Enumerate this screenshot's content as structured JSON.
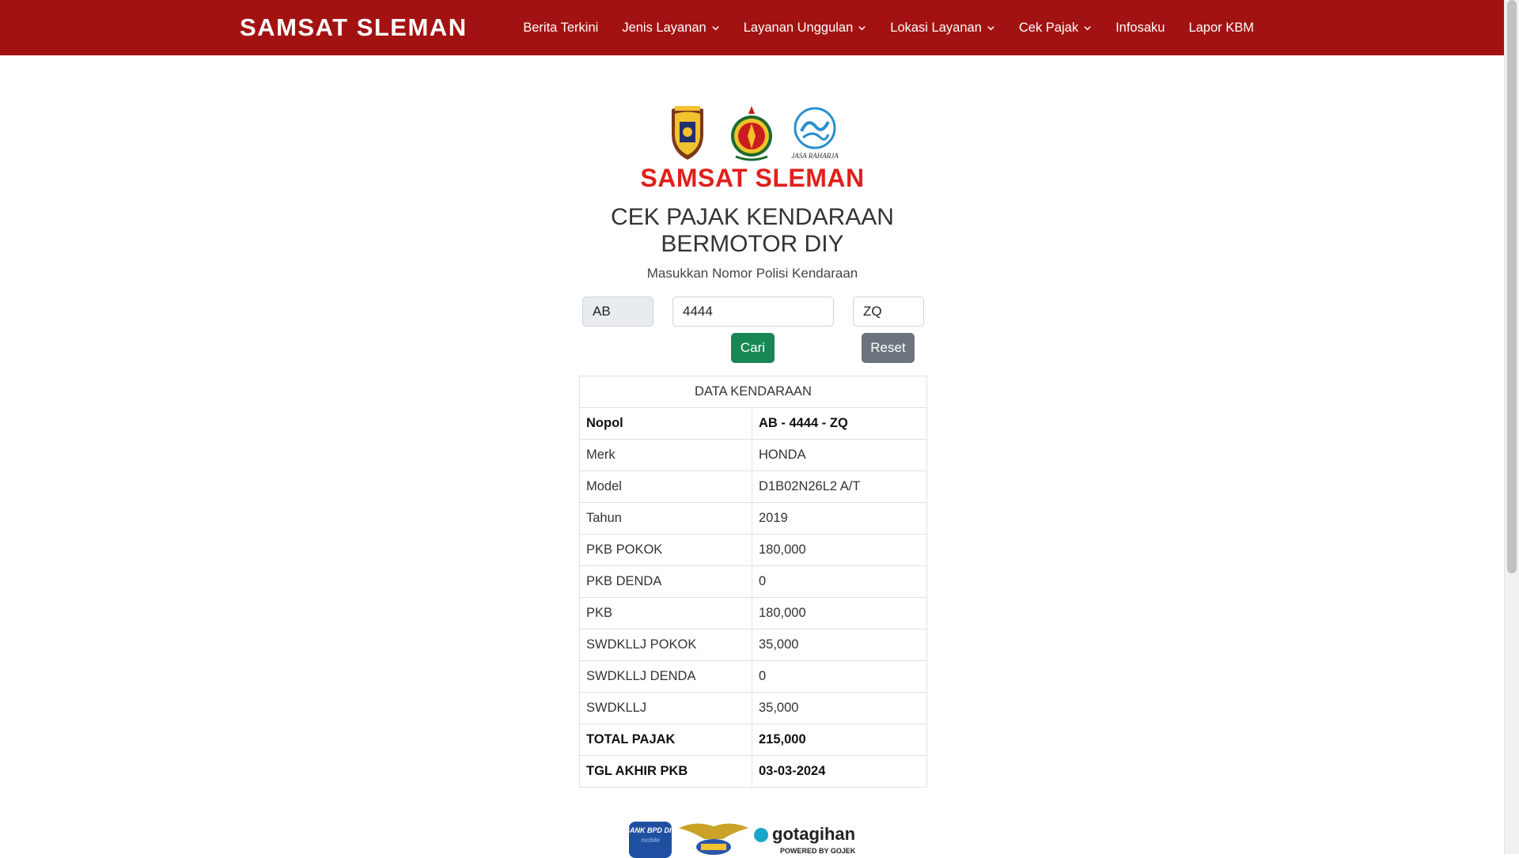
{
  "navbar": {
    "brand": "SAMSAT SLEMAN",
    "items": [
      {
        "label": "Berita Terkini",
        "dropdown": false
      },
      {
        "label": "Jenis Layanan",
        "dropdown": true
      },
      {
        "label": "Layanan Unggulan",
        "dropdown": true
      },
      {
        "label": "Lokasi Layanan",
        "dropdown": true
      },
      {
        "label": "Cek Pajak",
        "dropdown": true
      },
      {
        "label": "Infosaku",
        "dropdown": false
      },
      {
        "label": "Lapor KBM",
        "dropdown": false
      }
    ]
  },
  "header": {
    "logo_title": "SAMSAT SLEMAN",
    "logo_caption": "JASA RAHARJA",
    "title_line1": "CEK PAJAK KENDARAAN",
    "title_line2": "BERMOTOR DIY",
    "subtitle": "Masukkan Nomor Polisi Kendaraan"
  },
  "form": {
    "prefix_value": "AB",
    "number_value": "4444",
    "suffix_value": "ZQ",
    "search_label": "Cari",
    "reset_label": "Reset"
  },
  "table": {
    "header": "DATA KENDARAAN",
    "rows": [
      {
        "key": "Nopol",
        "value": "AB - 4444 - ZQ"
      },
      {
        "key": "Merk",
        "value": "HONDA"
      },
      {
        "key": "Model",
        "value": "D1B02N26L2 A/T"
      },
      {
        "key": "Tahun",
        "value": "2019"
      },
      {
        "key": "PKB POKOK",
        "value": "180,000"
      },
      {
        "key": "PKB DENDA",
        "value": "0"
      },
      {
        "key": "PKB",
        "value": "180,000"
      },
      {
        "key": "SWDKLLJ POKOK",
        "value": "35,000"
      },
      {
        "key": "SWDKLLJ DENDA",
        "value": "0"
      },
      {
        "key": "SWDKLLJ",
        "value": "35,000"
      },
      {
        "key": "TOTAL PAJAK",
        "value": "215,000"
      },
      {
        "key": "TGL AKHIR PKB",
        "value": "03-03-2024"
      }
    ]
  },
  "footer": {
    "bank_logo_text": "BANK BPD DIY",
    "bank_logo_sub": "mobile",
    "gotagihan_text": "gotagihan",
    "gotagihan_sub": "POWERED BY GOJEK"
  },
  "colors": {
    "navbar": "#a31212",
    "logo_title": "#e0201b",
    "btn_search": "#198754",
    "btn_reset": "#6c757d"
  }
}
